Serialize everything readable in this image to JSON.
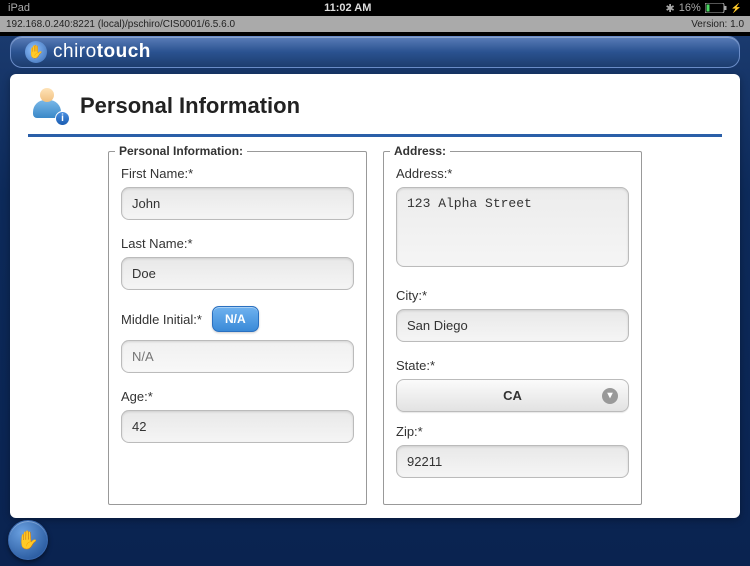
{
  "status_bar": {
    "carrier": "iPad",
    "time": "11:02 AM",
    "battery_pct": "16%"
  },
  "url_bar": {
    "left": "192.168.0.240:8221 (local)/pschiro/CIS0001/6.5.6.0",
    "right": "Version: 1.0"
  },
  "brand": {
    "part1": "chiro",
    "part2": "touch"
  },
  "page": {
    "title": "Personal Information"
  },
  "personal": {
    "legend": "Personal Information:",
    "first_name_label": "First Name:*",
    "first_name": "John",
    "last_name_label": "Last Name:*",
    "last_name": "Doe",
    "middle_label": "Middle Initial:*",
    "na_badge": "N/A",
    "middle_placeholder": "N/A",
    "age_label": "Age:*",
    "age": "42"
  },
  "address": {
    "legend": "Address:",
    "address_label": "Address:*",
    "address_value": "123 Alpha Street",
    "city_label": "City:*",
    "city": "San Diego",
    "state_label": "State:*",
    "state": "CA",
    "zip_label": "Zip:*",
    "zip": "92211"
  }
}
